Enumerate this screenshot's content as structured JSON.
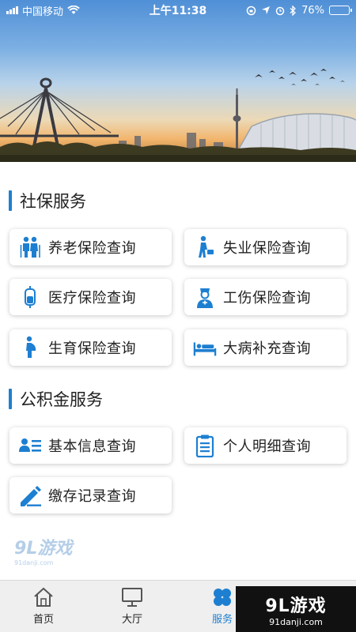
{
  "status_bar": {
    "carrier": "中国移动",
    "time": "上午11:38",
    "battery": "76%",
    "battery_level": 0.76
  },
  "social": {
    "title": "社保服务",
    "items": [
      {
        "label": "养老保险查询",
        "icon": "elderly-couple-icon"
      },
      {
        "label": "失业保险查询",
        "icon": "walking-person-briefcase-icon"
      },
      {
        "label": "医疗保险查询",
        "icon": "iv-drip-icon"
      },
      {
        "label": "工伤保险查询",
        "icon": "nurse-icon"
      },
      {
        "label": "生育保险查询",
        "icon": "pregnant-woman-icon"
      },
      {
        "label": "大病补充查询",
        "icon": "hospital-bed-icon"
      }
    ]
  },
  "fund": {
    "title": "公积金服务",
    "items": [
      {
        "label": "基本信息查询",
        "icon": "user-info-icon"
      },
      {
        "label": "个人明细查询",
        "icon": "clipboard-list-icon"
      },
      {
        "label": "缴存记录查询",
        "icon": "edit-record-icon"
      }
    ]
  },
  "watermark": {
    "logo_text": "9L游戏",
    "domain": "91danji.com"
  },
  "tabbar": {
    "tabs": [
      {
        "label": "首页",
        "icon": "home-icon"
      },
      {
        "label": "大厅",
        "icon": "monitor-icon"
      },
      {
        "label": "服务",
        "icon": "clover-icon",
        "active": true
      }
    ]
  },
  "colors": {
    "accent": "#1d7fd1",
    "card_bg": "#ffffff",
    "tabbar_bg": "#efefef"
  }
}
